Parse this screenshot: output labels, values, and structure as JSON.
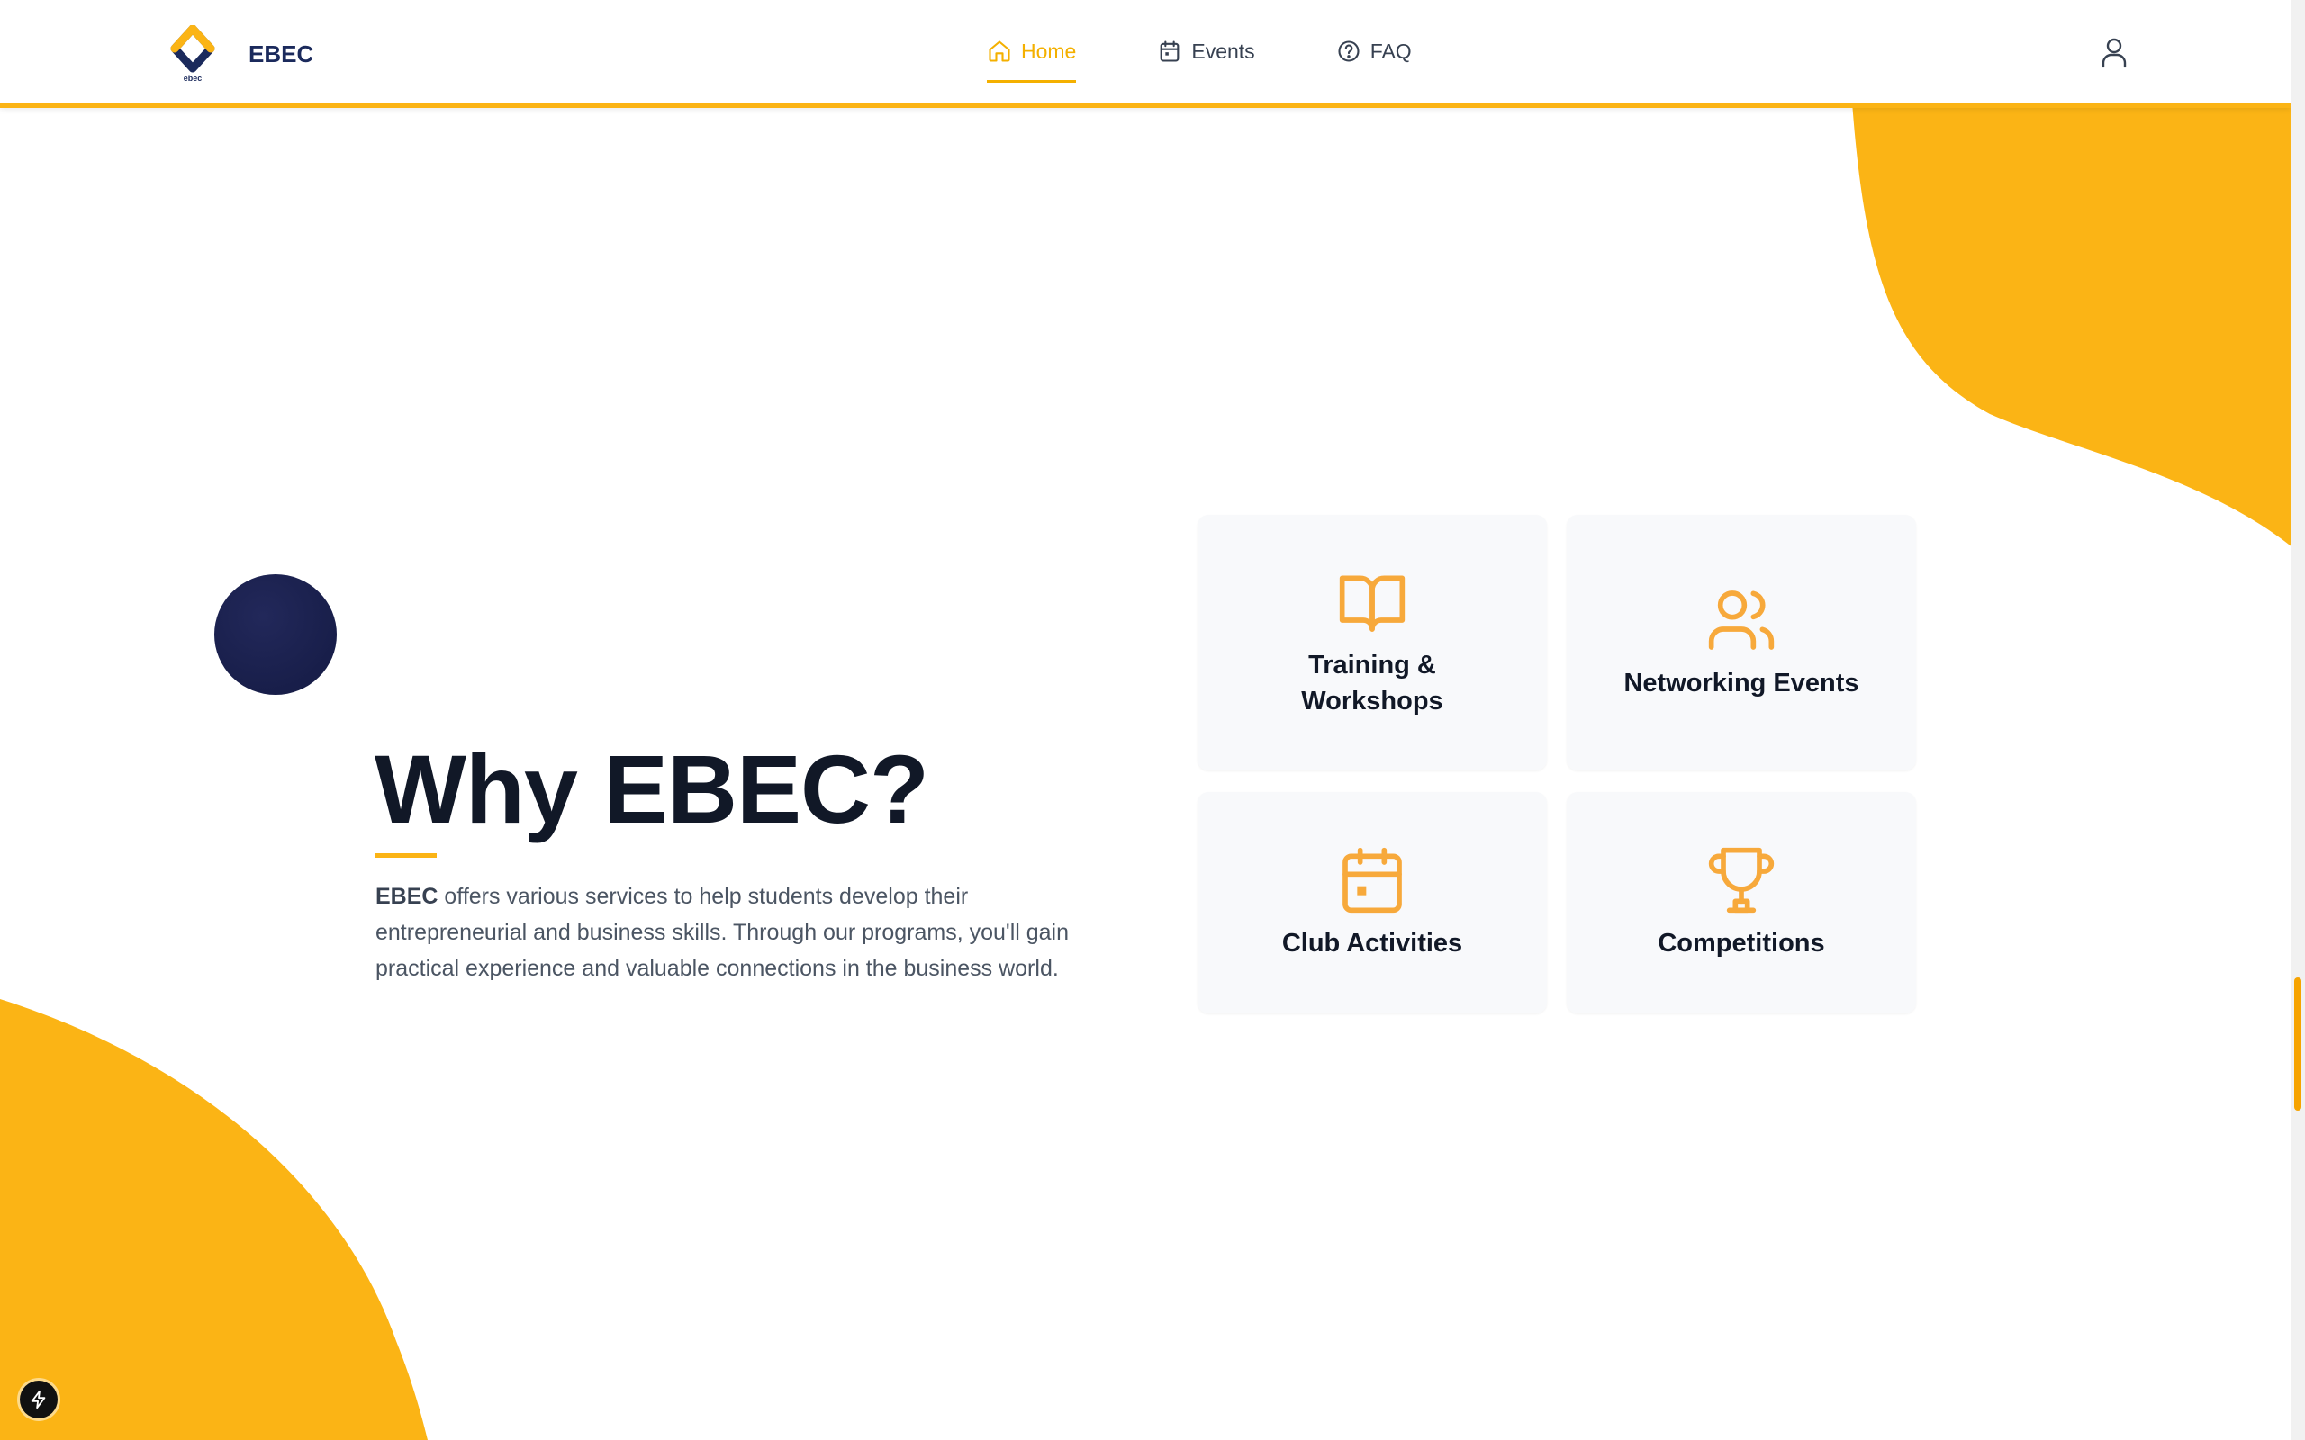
{
  "brand": {
    "name": "EBEC",
    "logo_text": "ebec",
    "logo_icon": "ebec-logo"
  },
  "nav": {
    "items": [
      {
        "label": "Home",
        "icon": "home-icon",
        "active": true
      },
      {
        "label": "Events",
        "icon": "calendar-icon",
        "active": false
      },
      {
        "label": "FAQ",
        "icon": "help-circle-icon",
        "active": false
      }
    ],
    "user_icon": "user-icon"
  },
  "hero": {
    "title": "Why EBEC?",
    "description_strong": "EBEC",
    "description_rest": " offers various services to help students develop their entrepreneurial and business skills. Through our programs, you'll gain practical experience and valuable connections in the business world."
  },
  "services": [
    {
      "title": "Training & Workshops",
      "icon": "book-open-icon"
    },
    {
      "title": "Networking Events",
      "icon": "users-icon"
    },
    {
      "title": "Club Activities",
      "icon": "calendar-icon"
    },
    {
      "title": "Competitions",
      "icon": "trophy-icon"
    }
  ],
  "dev_button": {
    "icon": "lightning-icon"
  },
  "colors": {
    "accent": "#fbb415",
    "accent_text": "#f4b000",
    "icon_orange": "#f7a93b",
    "navy": "#1b2a5c",
    "circle": "#181e4b",
    "heading": "#111827",
    "body_text": "#4b5563",
    "card_bg": "#f8f9fb"
  }
}
